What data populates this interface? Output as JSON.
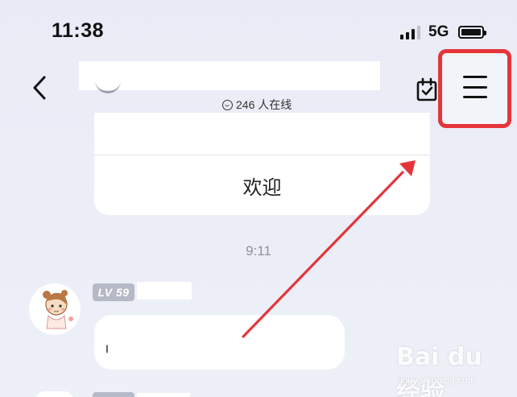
{
  "status_bar": {
    "time": "11:38",
    "network": "5G"
  },
  "header": {
    "online_count": "246 人在线"
  },
  "card": {
    "button_label": "欢迎"
  },
  "chat": {
    "time_separator": "9:11",
    "message": {
      "level_badge": "LV 59",
      "text": "I"
    }
  },
  "colors": {
    "highlight": "#e5353a",
    "annotation_arrow": "#e5353a",
    "background": "#eceef7"
  },
  "watermark": {
    "brand": "Bai du 经验",
    "url": "jingyan.baidu.com"
  }
}
